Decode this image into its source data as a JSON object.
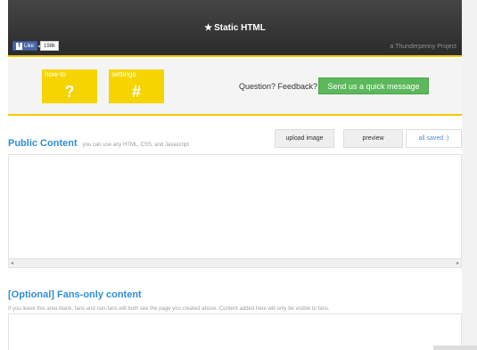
{
  "header": {
    "title": "Static HTML",
    "like_label": "Like",
    "like_count": "198k",
    "credit": "a Thunderpenny Project"
  },
  "toolbar": {
    "howto_label": "how-to",
    "howto_glyph": "?",
    "settings_label": "settings",
    "settings_glyph": "#",
    "feedback_prompt": "Question? Feedback?",
    "feedback_button": "Send us a quick message"
  },
  "public_content": {
    "title": "Public Content",
    "subtitle": "you can use any HTML, CSS, and Javascript",
    "upload_button": "upload image",
    "preview_button": "preview",
    "saved_status": "all saved :)"
  },
  "fans_content": {
    "title": "[Optional] Fans-only content",
    "description": "If you leave this area blank, fans and non-fans will both see the page you created above. Content added here will only be visible to fans."
  },
  "colors": {
    "accent_yellow": "#f5d400",
    "heading_blue": "#2f8fd6",
    "button_green": "#5cb85c",
    "header_dark": "#333333"
  }
}
